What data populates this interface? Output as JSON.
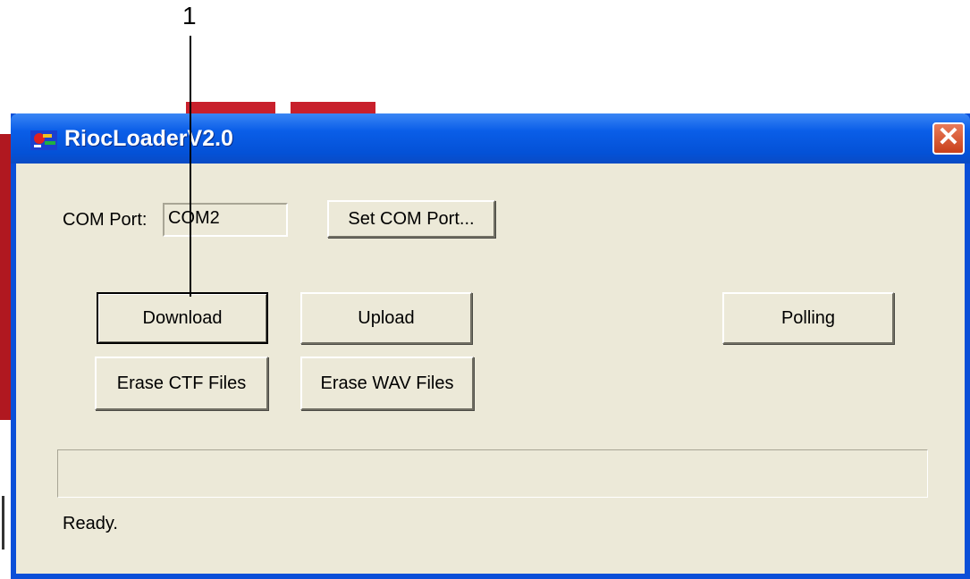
{
  "callout": {
    "number": "1"
  },
  "window": {
    "title": "RiocLoaderV2.0",
    "close_label": "✕"
  },
  "com_port": {
    "label": "COM Port:",
    "value": "COM2",
    "set_button": "Set COM Port..."
  },
  "buttons": {
    "download": "Download",
    "upload": "Upload",
    "polling": "Polling",
    "erase_ctf": "Erase CTF Files",
    "erase_wav": "Erase WAV Files"
  },
  "progress": {
    "value": 0
  },
  "status": {
    "text": "Ready."
  }
}
